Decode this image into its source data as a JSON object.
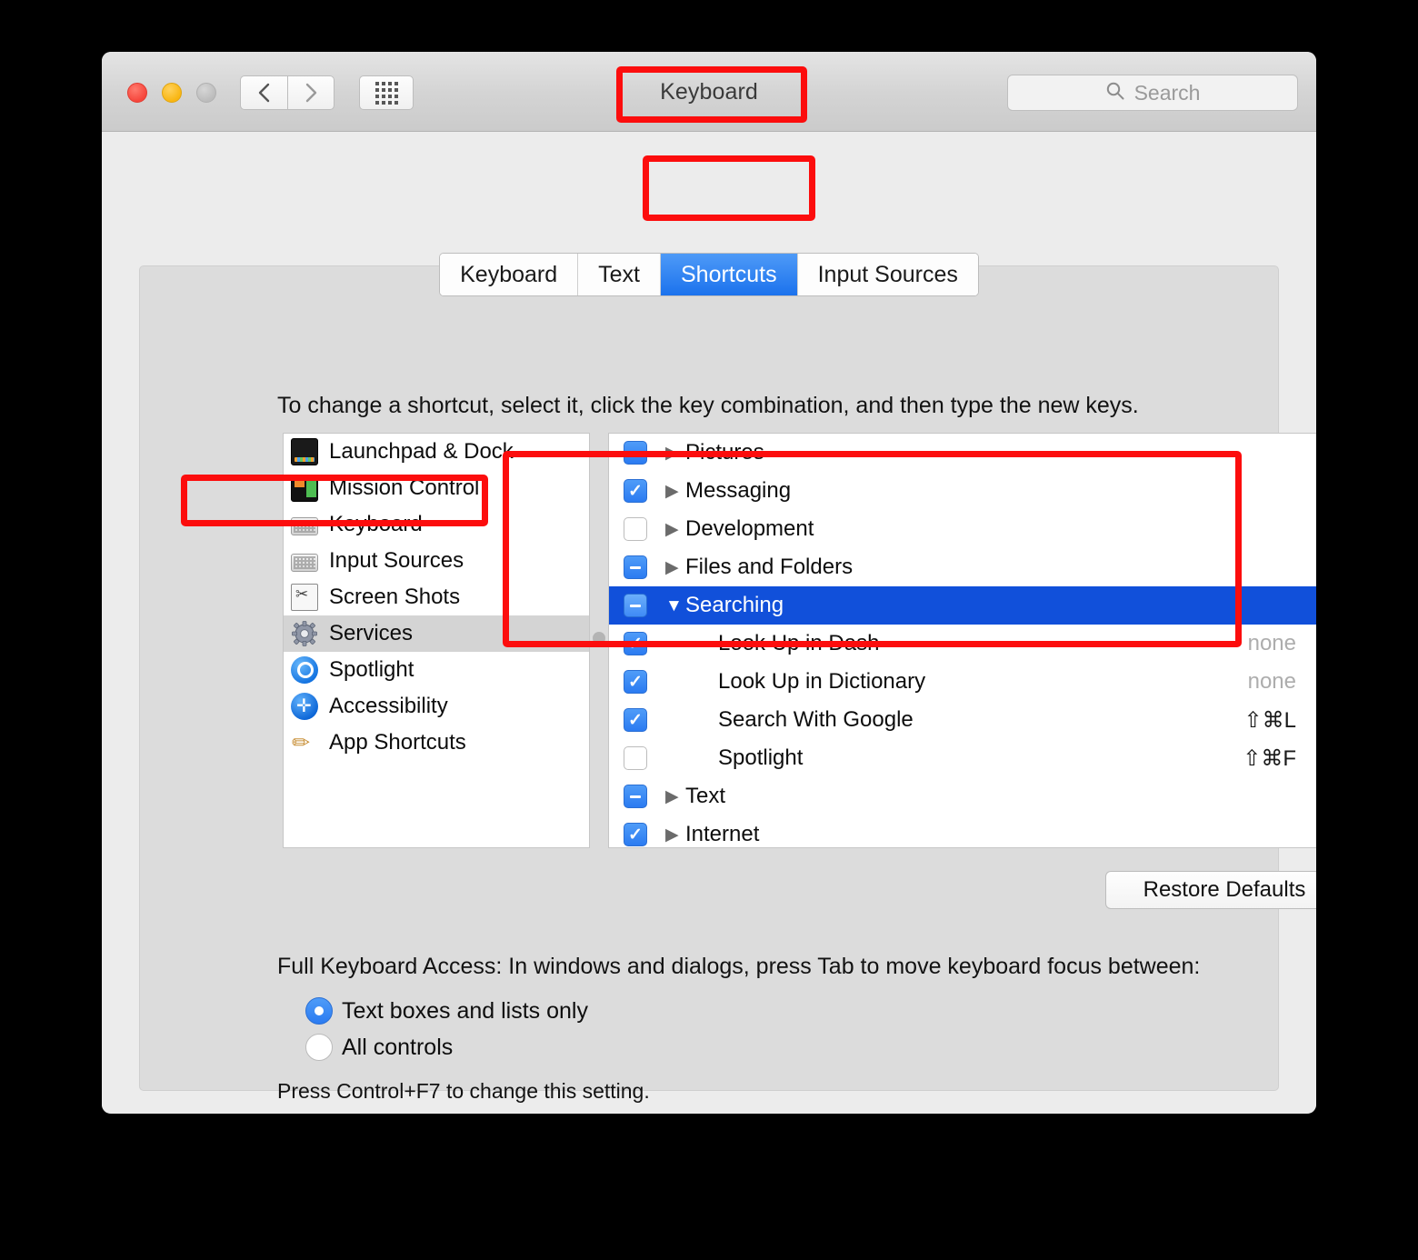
{
  "window": {
    "title": "Keyboard",
    "traffic_lights": [
      "close",
      "minimize",
      "zoom"
    ],
    "search": {
      "placeholder": "Search",
      "value": ""
    }
  },
  "tabs": [
    {
      "label": "Keyboard",
      "active": false
    },
    {
      "label": "Text",
      "active": false
    },
    {
      "label": "Shortcuts",
      "active": true
    },
    {
      "label": "Input Sources",
      "active": false
    }
  ],
  "instructions": "To change a shortcut, select it, click the key combination, and then type the new keys.",
  "categories": [
    {
      "label": "Launchpad & Dock",
      "icon": "launchpad-dock-icon",
      "selected": false
    },
    {
      "label": "Mission Control",
      "icon": "mission-control-icon",
      "selected": false
    },
    {
      "label": "Keyboard",
      "icon": "keyboard-icon",
      "selected": false
    },
    {
      "label": "Input Sources",
      "icon": "input-sources-icon",
      "selected": false
    },
    {
      "label": "Screen Shots",
      "icon": "screen-shots-icon",
      "selected": false
    },
    {
      "label": "Services",
      "icon": "services-gear-icon",
      "selected": true
    },
    {
      "label": "Spotlight",
      "icon": "spotlight-icon",
      "selected": false
    },
    {
      "label": "Accessibility",
      "icon": "accessibility-icon",
      "selected": false
    },
    {
      "label": "App Shortcuts",
      "icon": "app-shortcuts-icon",
      "selected": false
    }
  ],
  "shortcuts": [
    {
      "label": "Pictures",
      "check": "mixed",
      "disclosure": "collapsed",
      "child": false,
      "shortcut": "",
      "selected": false
    },
    {
      "label": "Messaging",
      "check": "checked",
      "disclosure": "collapsed",
      "child": false,
      "shortcut": "",
      "selected": false
    },
    {
      "label": "Development",
      "check": "unchecked",
      "disclosure": "collapsed",
      "child": false,
      "shortcut": "",
      "selected": false
    },
    {
      "label": "Files and Folders",
      "check": "mixed",
      "disclosure": "collapsed",
      "child": false,
      "shortcut": "",
      "selected": false
    },
    {
      "label": "Searching",
      "check": "mixed",
      "disclosure": "expanded",
      "child": false,
      "shortcut": "",
      "selected": true
    },
    {
      "label": "Look Up in Dash",
      "check": "checked",
      "disclosure": "none",
      "child": true,
      "shortcut": "none",
      "shortcut_none": true,
      "selected": false
    },
    {
      "label": "Look Up in Dictionary",
      "check": "checked",
      "disclosure": "none",
      "child": true,
      "shortcut": "none",
      "shortcut_none": true,
      "selected": false
    },
    {
      "label": "Search With Google",
      "check": "checked",
      "disclosure": "none",
      "child": true,
      "shortcut": "⇧⌘L",
      "shortcut_none": false,
      "selected": false
    },
    {
      "label": "Spotlight",
      "check": "unchecked",
      "disclosure": "none",
      "child": true,
      "shortcut": "⇧⌘F",
      "shortcut_none": false,
      "selected": false
    },
    {
      "label": "Text",
      "check": "mixed",
      "disclosure": "collapsed",
      "child": false,
      "shortcut": "",
      "selected": false
    },
    {
      "label": "Internet",
      "check": "checked",
      "disclosure": "collapsed",
      "child": false,
      "shortcut": "",
      "selected": false
    }
  ],
  "restore_defaults": "Restore Defaults",
  "full_keyboard_access": {
    "label": "Full Keyboard Access: In windows and dialogs, press Tab to move keyboard focus between:",
    "options": [
      {
        "label": "Text boxes and lists only",
        "selected": true
      },
      {
        "label": "All controls",
        "selected": false
      }
    ],
    "note": "Press Control+F7 to change this setting."
  },
  "help_glyph": "?",
  "colors": {
    "accent_blue": "#1b72ed",
    "selection_blue": "#1150da",
    "annotation_red": "#fc0d0d",
    "window_bg": "#ececec",
    "panel_bg": "#dcdcdc"
  }
}
